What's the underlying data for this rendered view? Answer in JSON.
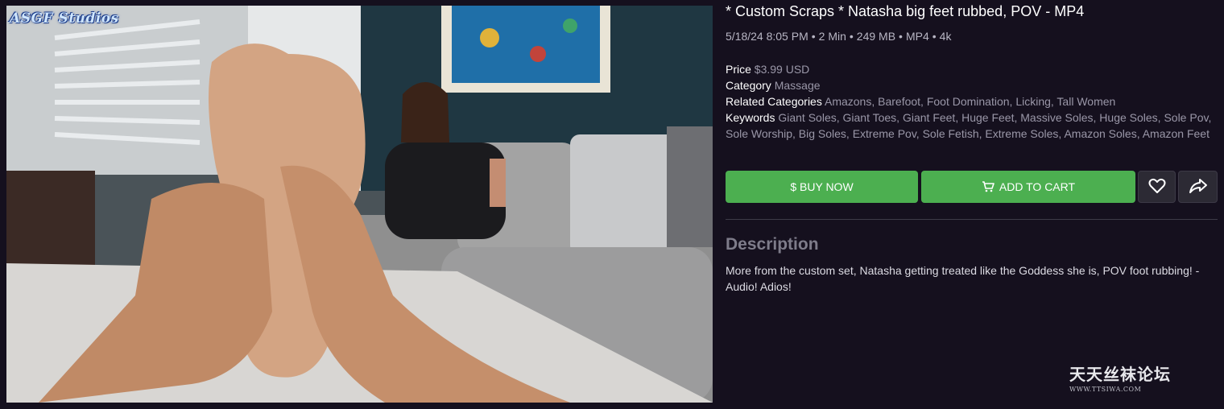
{
  "preview": {
    "watermark": "ASGF Studios"
  },
  "product": {
    "title": "* Custom Scraps * Natasha big feet rubbed, POV - MP4",
    "meta": {
      "date": "5/18/24 8:05 PM",
      "duration": "2 Min",
      "size": "249 MB",
      "format": "MP4",
      "resolution": "4k",
      "separator": "•"
    },
    "price_label": "Price",
    "price_value": "$3.99 USD",
    "category_label": "Category",
    "category_value": "Massage",
    "related_label": "Related Categories",
    "related_value": "Amazons, Barefoot, Foot Domination, Licking, Tall Women",
    "keywords_label": "Keywords",
    "keywords_value": "Giant Soles, Giant Toes, Giant Feet, Huge Feet, Massive Soles, Huge Soles, Sole Pov, Sole Worship, Big Soles, Extreme Pov, Sole Fetish, Extreme Soles, Amazon Soles, Amazon Feet"
  },
  "actions": {
    "buy_now": "$ BUY NOW",
    "add_to_cart": "ADD TO CART",
    "favorite_icon": "heart-icon",
    "share_icon": "share-icon",
    "accent_color": "#4caf50"
  },
  "description": {
    "heading": "Description",
    "text": "More from the custom set, Natasha getting treated like the Goddess she is, POV foot rubbing! - Audio! Adios!"
  },
  "site_watermark": {
    "name": "天天丝袜论坛",
    "url": "WWW.TTSIWA.COM"
  }
}
